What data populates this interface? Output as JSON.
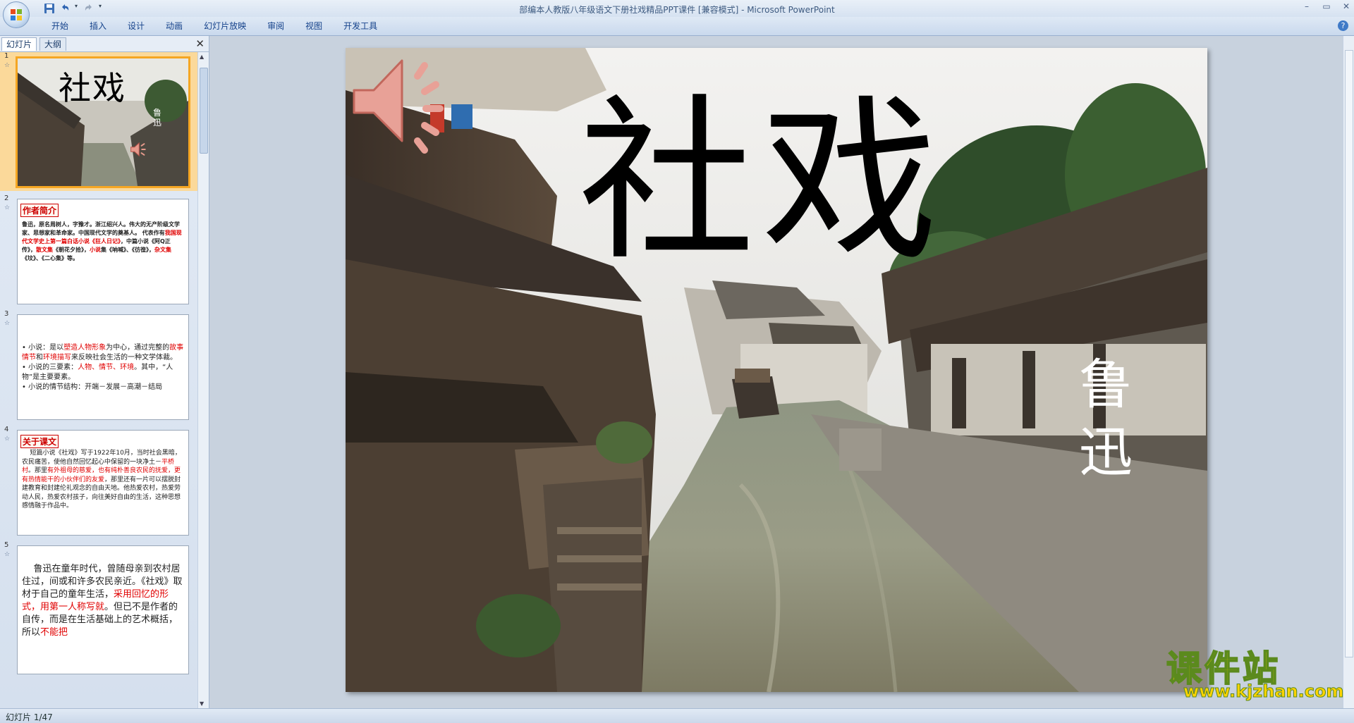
{
  "window": {
    "title": "部编本人教版八年级语文下册社戏精品PPT课件 [兼容模式] - Microsoft PowerPoint"
  },
  "ribbon": {
    "tabs": [
      "开始",
      "插入",
      "设计",
      "动画",
      "幻灯片放映",
      "审阅",
      "视图",
      "开发工具"
    ]
  },
  "left_pane": {
    "tab_slides": "幻灯片",
    "tab_outline": "大纲",
    "close": "✕",
    "slides": [
      {
        "num": "1",
        "title": "社戏",
        "author": "鲁迅"
      },
      {
        "num": "2",
        "heading": "作者简介",
        "lines": [
          {
            "text": "鲁迅，原名周树人，字豫才。浙江绍兴人。伟大的无产阶级文学家、思想家和革命家。中国现代文学的奠基人。"
          },
          {
            "text": "代表作有"
          },
          {
            "text": "我国现代文学史上第一篇白话小说《狂人日记》"
          },
          {
            "text": "，中篇小说《阿Q正传》，"
          },
          {
            "text": "散文集"
          },
          {
            "text": "《朝花夕拾》，"
          },
          {
            "text": "小说"
          },
          {
            "text": "集《呐喊》、《彷徨》，"
          },
          {
            "text": "杂文集"
          },
          {
            "text": "《坟》、《二心集》等。"
          }
        ]
      },
      {
        "num": "3",
        "b1a": "小说：是以",
        "b1b": "塑造人物形象",
        "b1c": "为中心，通过完整的",
        "b1d": "故事情节",
        "b1e": "和",
        "b1f": "环境描写",
        "b1g": "来反映社会生活的一种文学体裁。",
        "b2a": "小说的三要素：",
        "b2b": "人物、情节、环境",
        "b2c": "。其中，“人物”是主要要素。",
        "b3": "小说的情节结构：开端－发展－高潮－结局"
      },
      {
        "num": "4",
        "heading": "关于课文",
        "p1": "短篇小说《社戏》写于1922年10月，当时社会黑暗，农民痛苦，使他自然回忆起心中保留的一块净土－",
        "p2": "平桥村",
        "p3": "。那里",
        "p4": "有外祖母的慈爱，也有纯朴善良农民的抚爱，更有热情能干的小伙伴们的友爱",
        "p5": "，那里还有一片可以摆脱封建教育和封建伦礼观念的自由天地。他热爱农村，热爱劳动人民，热爱农村孩子，向往美好自由的生活，这种思想感情融于作品中。"
      },
      {
        "num": "5",
        "p1": "鲁迅在童年时代，曾随母亲到农村居住过，间或和许多农民亲近。《社戏》取材于自己的童年生活，",
        "p2": "采用回忆的形式，用第一人称写就",
        "p3": "。但已不是作者的自传，而是在生活基础上的艺术概括，所以",
        "p4": "不能把"
      }
    ]
  },
  "slide": {
    "title": "社戏",
    "author_line1": "鲁",
    "author_line2": "迅"
  },
  "watermark": {
    "cn": "课件站",
    "url": "www.kjzhan.com"
  },
  "status": {
    "text": "幻灯片 1/47"
  },
  "icons": [
    "office-button-icon",
    "save-icon",
    "undo-icon",
    "redo-icon",
    "speaker-icon",
    "star-icon"
  ]
}
